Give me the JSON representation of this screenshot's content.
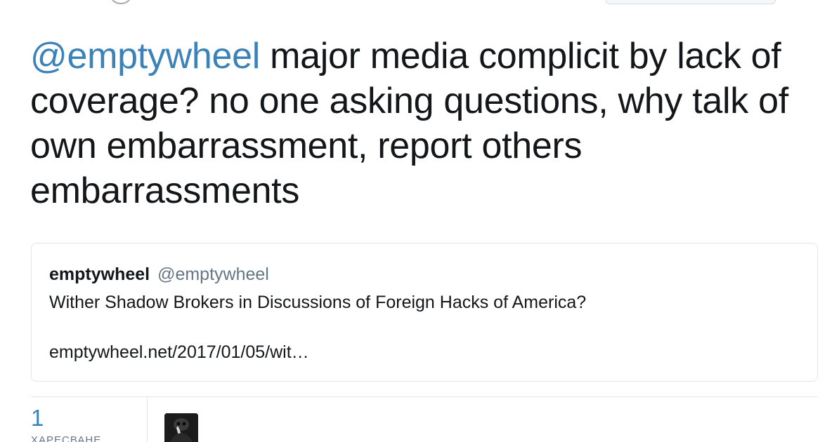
{
  "tweet": {
    "mention": "@emptywheel",
    "text": " major media complicit by lack of coverage? no one asking questions,  why talk of own embarrassment, report others embarrassments"
  },
  "quoted_tweet": {
    "name": "emptywheel",
    "handle": "@emptywheel",
    "body": "Wither Shadow Brokers in Discussions of Foreign Hacks of America?",
    "link": "emptywheel.net/2017/01/05/wit…"
  },
  "stats": {
    "count": "1",
    "label": "ХАРЕСВАНЕ"
  },
  "colors": {
    "mention": "#3b82b9",
    "text": "#14171a",
    "muted": "#657786",
    "border": "#e1e8ed"
  }
}
